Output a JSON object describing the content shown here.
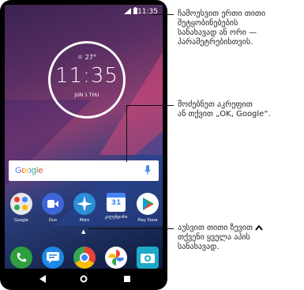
{
  "status_bar": {
    "time": "11:35"
  },
  "clock_widget": {
    "weather": "27°",
    "time": "11:35",
    "date": "JUN 1 THU"
  },
  "search_bar": {
    "logo_text": "Google"
  },
  "apps": [
    {
      "label": "Google",
      "icon": "google-folder-icon"
    },
    {
      "label": "Duo",
      "icon": "duo-icon"
    },
    {
      "label": "Moto",
      "icon": "moto-icon"
    },
    {
      "label": "კალენდარი",
      "icon": "calendar-icon",
      "icon_text": "31"
    },
    {
      "label": "Play Store",
      "icon": "play-store-icon"
    }
  ],
  "dock": [
    {
      "icon": "phone-icon"
    },
    {
      "icon": "messages-icon"
    },
    {
      "icon": "chrome-icon"
    },
    {
      "icon": "photos-icon"
    },
    {
      "icon": "camera-icon"
    }
  ],
  "annotations": {
    "settings": [
      "ჩამოუსვით ერთი თითი",
      "შეტყობინებების",
      "სანახავად ან ორი —",
      "პარამეტრებისთვის."
    ],
    "search": [
      "მოძებნეთ აკრეფით",
      "ან თქვით „OK, Google“."
    ],
    "apps": [
      "აუსვით თითი ზევით",
      "თქვენი ყველა აპის",
      "სანახავად."
    ]
  },
  "colors": {
    "phone_frame": "#000000",
    "search_mic": "#4285F4"
  }
}
